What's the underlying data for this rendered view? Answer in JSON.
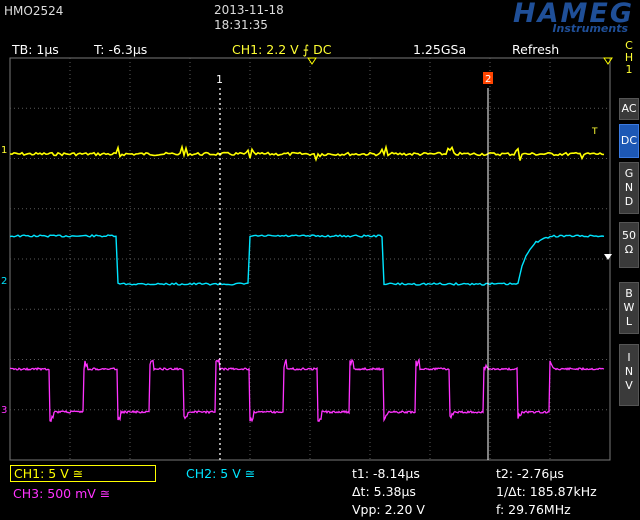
{
  "header": {
    "model": "HMO2524",
    "date": "2013-11-18",
    "time": "18:31:35",
    "brand": "HAMEG",
    "brand_sub": "Instruments"
  },
  "status_bar": {
    "timebase": "TB: 1µs",
    "trigger_time": "T: -6.3µs",
    "ch1_setting": "CH1: 2.2 V ⨍ DC",
    "sample_rate": "1.25GSa",
    "mode": "Refresh"
  },
  "side_menu": {
    "channel": [
      "C",
      "H",
      "1"
    ],
    "buttons": [
      {
        "label": "AC",
        "active": false
      },
      {
        "label": "DC",
        "active": true
      },
      {
        "label": "G N D",
        "active": false
      },
      {
        "label": "50 Ω",
        "active": false
      },
      {
        "label": "B W L",
        "active": false
      },
      {
        "label": "I N V",
        "active": false
      }
    ]
  },
  "markers": {
    "ch_markers": [
      "1",
      "2",
      "3"
    ],
    "cursor1": "1",
    "cursor2": "2",
    "trigger_marker": "T"
  },
  "channels": {
    "ch1": {
      "label": "CH1: 5 V ≅",
      "color": "#ffff00"
    },
    "ch2": {
      "label": "CH2: 5 V ≅",
      "color": "#00e5ff"
    },
    "ch3": {
      "label": "CH3: 500 mV ≅",
      "color": "#ff33ff"
    }
  },
  "measurements": {
    "t1": "t1: -8.14µs",
    "t2": "t2: -2.76µs",
    "dt": "Δt: 5.38µs",
    "inv_dt": "1/Δt: 185.87kHz",
    "vpp": "Vpp: 2.20 V",
    "freq": "f: 29.76MHz"
  },
  "colors": {
    "ch1": "#ffff00",
    "ch2": "#00e5ff",
    "ch3": "#ff33ff",
    "brand": "#1f4f98",
    "side_active": "#1d58b5",
    "cursor2": "#ff4400"
  }
}
